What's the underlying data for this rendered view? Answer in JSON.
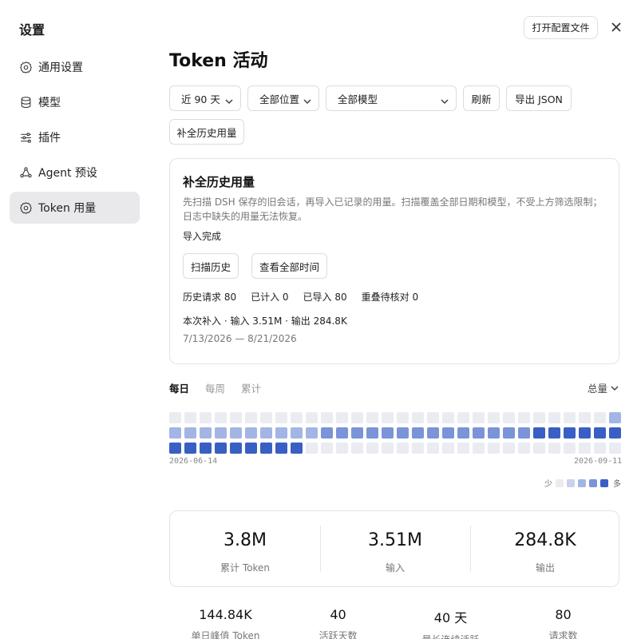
{
  "sidebar": {
    "title": "设置",
    "items": [
      {
        "label": "通用设置",
        "icon": "gear-icon"
      },
      {
        "label": "模型",
        "icon": "database-icon"
      },
      {
        "label": "插件",
        "icon": "sliders-icon"
      },
      {
        "label": "Agent 预设",
        "icon": "agent-icon"
      },
      {
        "label": "Token 用量",
        "icon": "gear-icon"
      }
    ],
    "active_index": 4
  },
  "header": {
    "open_config_label": "打开配置文件",
    "close_icon": "close-icon",
    "page_title": "Token 活动"
  },
  "filters": {
    "range": "近 90 天",
    "location": "全部位置",
    "model": "全部模型",
    "refresh_label": "刷新",
    "export_label": "导出 JSON",
    "backfill_label": "补全历史用量"
  },
  "backfill_card": {
    "title": "补全历史用量",
    "desc": "先扫描 DSH 保存的旧会话，再导入已记录的用量。扫描覆盖全部日期和模型，不受上方筛选限制；日志中缺失的用量无法恢复。",
    "status": "导入完成",
    "scan_label": "扫描历史",
    "view_all_label": "查看全部时间",
    "stats": [
      "历史请求 80",
      "已计入 0",
      "已导入 80",
      "重叠待核对 0"
    ],
    "supplement": "本次补入 · 输入 3.51M · 输出 284.8K",
    "date_range": "7/13/2026 — 8/21/2026"
  },
  "view_tabs": [
    "每日",
    "每周",
    "累计"
  ],
  "active_tab": 0,
  "metric_select": "总量",
  "heatmap": {
    "start_label": "2026-06-14",
    "end_label": "2026-09-11",
    "legend_low": "少",
    "legend_high": "多",
    "palette": [
      "#ebecf1",
      "#dde2f0",
      "#c8d2ee",
      "#a3b5e4",
      "#7a94d8",
      "#3a5fc4"
    ],
    "levels": [
      0,
      0,
      0,
      0,
      0,
      0,
      0,
      0,
      0,
      0,
      0,
      0,
      0,
      0,
      0,
      0,
      0,
      0,
      0,
      0,
      0,
      0,
      0,
      0,
      0,
      0,
      0,
      0,
      0,
      0,
      0,
      3,
      3,
      3,
      3,
      3,
      3,
      3,
      3,
      3,
      3,
      3,
      4,
      4,
      4,
      4,
      4,
      4,
      4,
      4,
      4,
      4,
      4,
      4,
      4,
      4,
      4,
      4,
      4,
      4,
      4,
      4,
      4,
      4,
      5,
      5,
      5,
      5,
      5,
      5,
      5,
      5,
      5,
      0,
      0,
      0,
      0,
      0,
      0,
      0,
      0,
      0,
      0,
      0,
      0,
      0,
      0,
      0,
      0,
      0,
      0,
      0,
      0,
      0,
      0,
      0,
      5,
      5,
      5,
      5,
      5,
      5,
      5,
      5
    ]
  },
  "summary": [
    {
      "value": "3.8M",
      "label": "累计 Token"
    },
    {
      "value": "3.51M",
      "label": "输入"
    },
    {
      "value": "284.8K",
      "label": "输出"
    }
  ],
  "metrics": [
    {
      "value": "144.84K",
      "label": "单日峰值 Token"
    },
    {
      "value": "40",
      "label": "活跃天数"
    },
    {
      "value": "40 天",
      "label": "最长连续活跃"
    },
    {
      "value": "80",
      "label": "请求数"
    }
  ]
}
